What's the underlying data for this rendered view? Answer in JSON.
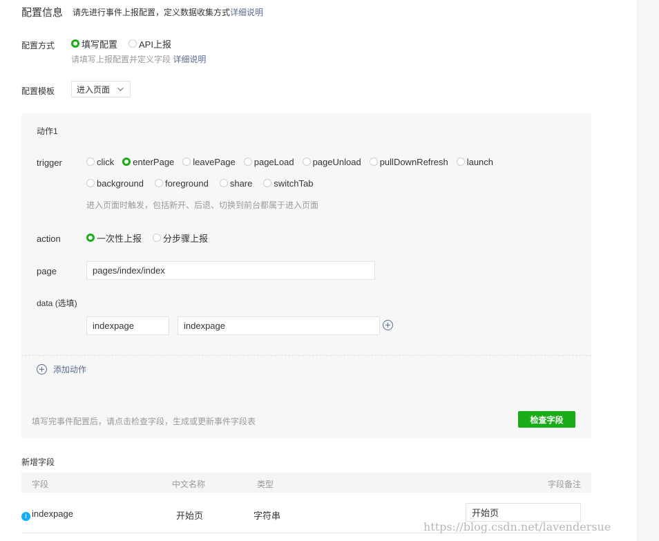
{
  "header": {
    "title": "配置信息",
    "description": "请先进行事件上报配置，定义数据收集方式",
    "link": "详细说明"
  },
  "config_method": {
    "label": "配置方式",
    "options": [
      {
        "label": "填写配置",
        "selected": true
      },
      {
        "label": "API上报",
        "selected": false
      }
    ],
    "hint": "请填写上报配置并定义字段",
    "hint_link": "详细说明"
  },
  "config_template": {
    "label": "配置模板",
    "selected": "进入页面"
  },
  "action_panel": {
    "title": "动作1",
    "trigger": {
      "label": "trigger",
      "options_row1": [
        {
          "label": "click",
          "selected": false
        },
        {
          "label": "enterPage",
          "selected": true
        },
        {
          "label": "leavePage",
          "selected": false
        },
        {
          "label": "pageLoad",
          "selected": false
        },
        {
          "label": "pageUnload",
          "selected": false
        },
        {
          "label": "pullDownRefresh",
          "selected": false
        },
        {
          "label": "launch",
          "selected": false
        }
      ],
      "options_row2": [
        {
          "label": "background",
          "selected": false
        },
        {
          "label": "foreground",
          "selected": false
        },
        {
          "label": "share",
          "selected": false
        },
        {
          "label": "switchTab",
          "selected": false
        }
      ],
      "hint": "进入页面时触发，包括新开、后退、切换到前台都属于进入页面"
    },
    "action": {
      "label": "action",
      "options": [
        {
          "label": "一次性上报",
          "selected": true
        },
        {
          "label": "分步骤上报",
          "selected": false
        }
      ]
    },
    "page": {
      "label": "page",
      "value": "pages/index/index"
    },
    "data": {
      "label": "data (选填)",
      "key": "indexpage",
      "value": "indexpage"
    },
    "add_action": "添加动作",
    "footer_hint": "填写完事件配置后，请点击检查字段，生成或更新事件字段表",
    "check_button": "检查字段"
  },
  "new_fields": {
    "title": "新增字段",
    "columns": [
      "字段",
      "中文名称",
      "类型",
      "字段备注"
    ],
    "rows": [
      {
        "field": "indexpage",
        "cn_name": "开始页",
        "type": "字符串",
        "remark": "开始页"
      }
    ]
  },
  "watermark": "https://blog.csdn.net/lavendersue",
  "colors": {
    "accent_green": "#1aad19",
    "link_blue": "#576b95",
    "info_blue": "#10aeff",
    "panel_bg": "#f7f7f7"
  }
}
